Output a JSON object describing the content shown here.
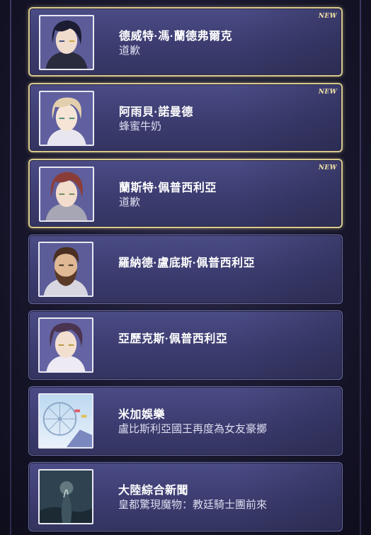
{
  "messages": [
    {
      "name": "德威特·馮·蘭德弗爾克",
      "subtitle": "道歉",
      "badge": "NEW",
      "is_new": true,
      "avatar_icon": "character-portrait-dark-hair"
    },
    {
      "name": "阿雨貝·諾曼德",
      "subtitle": "蜂蜜牛奶",
      "badge": "NEW",
      "is_new": true,
      "avatar_icon": "character-portrait-blond-hair"
    },
    {
      "name": "蘭斯特·佩普西利亞",
      "subtitle": "道歉",
      "badge": "NEW",
      "is_new": true,
      "avatar_icon": "character-portrait-red-hair"
    },
    {
      "name": "羅納德·盧底斯·佩普西利亞",
      "subtitle": "",
      "badge": "",
      "is_new": false,
      "avatar_icon": "character-portrait-bearded-man"
    },
    {
      "name": "亞歷克斯·佩普西利亞",
      "subtitle": "",
      "badge": "",
      "is_new": false,
      "avatar_icon": "character-portrait-purple-hair"
    },
    {
      "name": "米加娛樂",
      "subtitle": "盧比斯利亞國王再度為女友豪擲",
      "badge": "",
      "is_new": false,
      "avatar_icon": "ferris-wheel-image"
    },
    {
      "name": "大陸綜合新聞",
      "subtitle": "皇都驚現魔物：教廷騎士團前來",
      "badge": "",
      "is_new": false,
      "avatar_icon": "monster-night-image"
    }
  ]
}
